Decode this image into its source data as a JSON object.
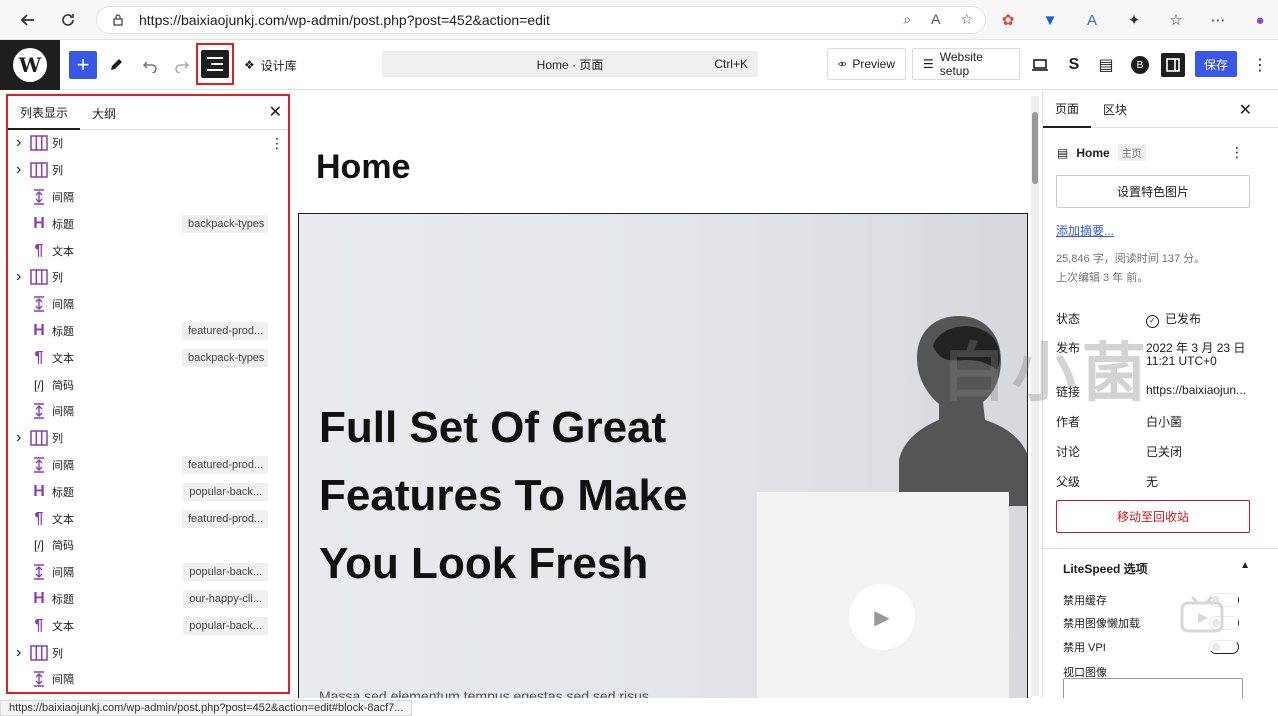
{
  "browser": {
    "url": "https://baixiaojunkj.com/wp-admin/post.php?post=452&action=edit"
  },
  "header": {
    "design_library": "设计库",
    "command_bar": "Home · 页面",
    "command_shortcut": "Ctrl+K",
    "preview": "Preview",
    "website_setup": "Website setup",
    "save": "保存"
  },
  "list_view": {
    "tabs": [
      "列表显示",
      "大纲"
    ],
    "items": [
      {
        "label": "列",
        "type": "columns",
        "expandable": true,
        "anchor": ""
      },
      {
        "label": "列",
        "type": "columns",
        "expandable": true,
        "anchor": ""
      },
      {
        "label": "间隔",
        "type": "spacer",
        "expandable": false,
        "anchor": ""
      },
      {
        "label": "标题",
        "type": "heading",
        "expandable": false,
        "anchor": "backpack-types"
      },
      {
        "label": "文本",
        "type": "paragraph",
        "expandable": false,
        "anchor": ""
      },
      {
        "label": "列",
        "type": "columns",
        "expandable": true,
        "anchor": ""
      },
      {
        "label": "间隔",
        "type": "spacer",
        "expandable": false,
        "anchor": ""
      },
      {
        "label": "标题",
        "type": "heading",
        "expandable": false,
        "anchor": "featured-prod..."
      },
      {
        "label": "文本",
        "type": "paragraph",
        "expandable": false,
        "anchor": "backpack-types"
      },
      {
        "label": "简码",
        "type": "shortcode",
        "expandable": false,
        "anchor": ""
      },
      {
        "label": "间隔",
        "type": "spacer",
        "expandable": false,
        "anchor": ""
      },
      {
        "label": "列",
        "type": "columns",
        "expandable": true,
        "anchor": ""
      },
      {
        "label": "间隔",
        "type": "spacer",
        "expandable": false,
        "anchor": "featured-prod..."
      },
      {
        "label": "标题",
        "type": "heading",
        "expandable": false,
        "anchor": "popular-back..."
      },
      {
        "label": "文本",
        "type": "paragraph",
        "expandable": false,
        "anchor": "featured-prod..."
      },
      {
        "label": "简码",
        "type": "shortcode",
        "expandable": false,
        "anchor": ""
      },
      {
        "label": "间隔",
        "type": "spacer",
        "expandable": false,
        "anchor": "popular-back..."
      },
      {
        "label": "标题",
        "type": "heading",
        "expandable": false,
        "anchor": "our-happy-cli..."
      },
      {
        "label": "文本",
        "type": "paragraph",
        "expandable": false,
        "anchor": "popular-back..."
      },
      {
        "label": "列",
        "type": "columns",
        "expandable": true,
        "anchor": ""
      },
      {
        "label": "间隔",
        "type": "spacer",
        "expandable": false,
        "anchor": ""
      }
    ]
  },
  "canvas": {
    "page_title": "Home",
    "hero_title": "Full Set Of Great Features To Make You Look Fresh",
    "hero_body": "Massa sed elementum tempus egestas sed sed risus"
  },
  "settings": {
    "tabs": [
      "页面",
      "区块"
    ],
    "page_name": "Home",
    "page_badge": "主页",
    "featured_image": "设置特色图片",
    "add_excerpt": "添加摘要...",
    "word_count": "25,846 字，阅读时间 137 分。",
    "last_edited": "上次编辑 3 年 前。",
    "rows": [
      {
        "key": "状态",
        "value": "已发布"
      },
      {
        "key": "发布",
        "value": "2022 年 3 月 23 日"
      },
      {
        "key": "",
        "value": "11:21 UTC+0"
      },
      {
        "key": "链接",
        "value": "https://baixiaojun..."
      },
      {
        "key": "作者",
        "value": "白小菌"
      },
      {
        "key": "讨论",
        "value": "已关闭"
      },
      {
        "key": "父级",
        "value": "无"
      }
    ],
    "move_to_trash": "移动至回收站",
    "litespeed_title": "LiteSpeed 选项",
    "litespeed_options": [
      "禁用缓存",
      "禁用图像懒加载",
      "禁用 VPI",
      "视口图像"
    ]
  },
  "watermark": "白小菌",
  "status_url": "https://baixiaojunkj.com/wp-admin/post.php?post=452&action=edit#block-8acf7..."
}
